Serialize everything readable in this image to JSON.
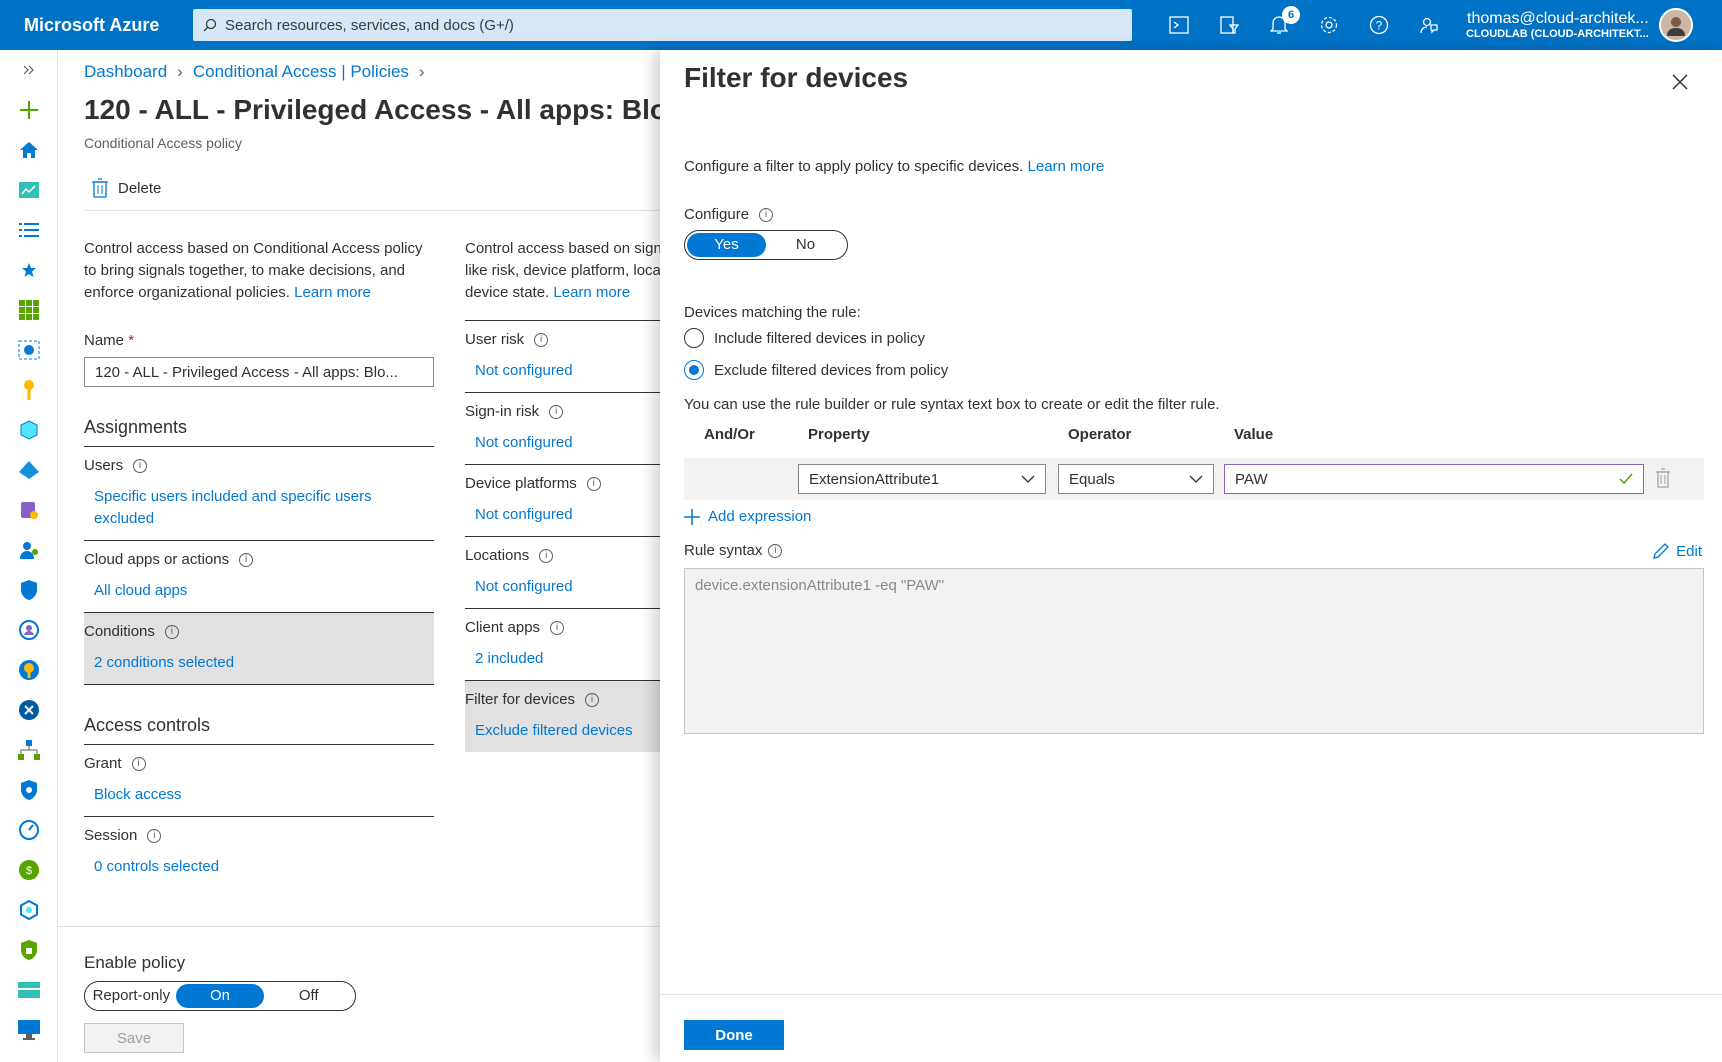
{
  "topbar": {
    "brand": "Microsoft Azure",
    "search_placeholder": "Search resources, services, and docs (G+/)",
    "notification_count": "6",
    "account_email": "thomas@cloud-architek...",
    "account_tenant": "CLOUDLAB (CLOUD-ARCHITEKT..."
  },
  "breadcrumb": [
    "Dashboard",
    "Conditional Access | Policies"
  ],
  "page": {
    "title": "120 - ALL - Privileged Access - All apps: Blo",
    "subtitle": "Conditional Access policy",
    "delete_label": "Delete"
  },
  "left": {
    "description": "Control access based on Conditional Access policy to bring signals together, to make decisions, and enforce organizational policies.",
    "learn_more": "Learn more",
    "name_label": "Name",
    "name_value": "120 - ALL - Privileged Access - All apps: Blo...",
    "assignments": "Assignments",
    "users_label": "Users",
    "users_value": "Specific users included and specific users excluded",
    "cloud_label": "Cloud apps or actions",
    "cloud_value": "All cloud apps",
    "conditions_label": "Conditions",
    "conditions_value": "2 conditions selected",
    "access_controls": "Access controls",
    "grant_label": "Grant",
    "grant_value": "Block access",
    "session_label": "Session",
    "session_value": "0 controls selected"
  },
  "right": {
    "description": "Control access based on signals from conditions like risk, device platform, location, client apps, or device state.",
    "learn_more": "Learn more",
    "user_risk": "User risk",
    "user_risk_value": "Not configured",
    "signin_risk": "Sign-in risk",
    "signin_risk_value": "Not configured",
    "device_platforms": "Device platforms",
    "device_platforms_value": "Not configured",
    "locations": "Locations",
    "locations_value": "Not configured",
    "client_apps": "Client apps",
    "client_apps_value": "2 included",
    "filter_devices": "Filter for devices",
    "filter_devices_value": "Exclude filtered devices"
  },
  "bottom": {
    "enable_policy": "Enable policy",
    "toggle": [
      "Report-only",
      "On",
      "Off"
    ],
    "save": "Save"
  },
  "panel": {
    "title": "Filter for devices",
    "description": "Configure a filter to apply policy to specific devices.",
    "learn_more": "Learn more",
    "configure_label": "Configure",
    "yes": "Yes",
    "no": "No",
    "matching_label": "Devices matching the rule:",
    "include_option": "Include filtered devices in policy",
    "exclude_option": "Exclude filtered devices from policy",
    "hint": "You can use the rule builder or rule syntax text box to create or edit the filter rule.",
    "col_andor": "And/Or",
    "col_property": "Property",
    "col_operator": "Operator",
    "col_value": "Value",
    "property_value": "ExtensionAttribute1",
    "operator_value": "Equals",
    "value_value": "PAW",
    "add_expression": "Add expression",
    "rule_syntax_label": "Rule syntax",
    "edit": "Edit",
    "rule_syntax": "device.extensionAttribute1 -eq \"PAW\"",
    "done": "Done"
  }
}
